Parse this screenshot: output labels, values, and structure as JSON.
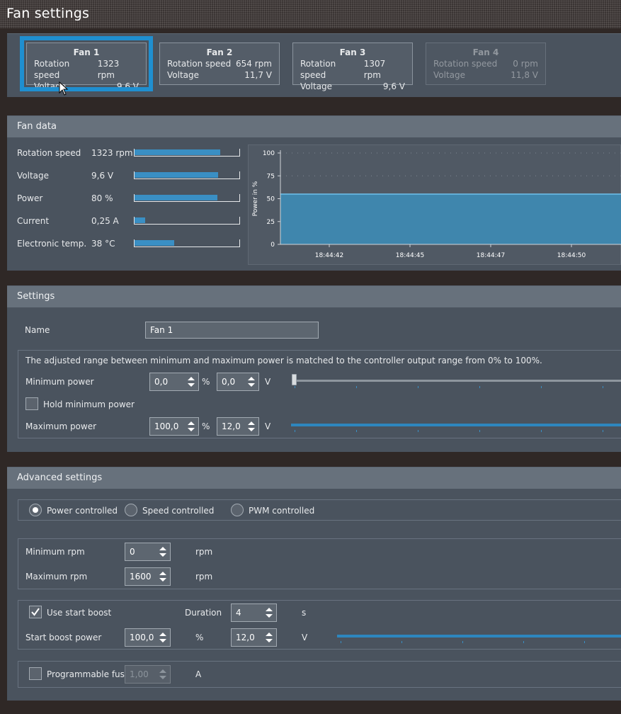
{
  "window": {
    "title": "Fan settings"
  },
  "fans": [
    {
      "title": "Fan 1",
      "rot_label": "Rotation speed",
      "rot_value": "1323 rpm",
      "volt_label": "Voltage",
      "volt_value": "9,6 V"
    },
    {
      "title": "Fan 2",
      "rot_label": "Rotation speed",
      "rot_value": "654 rpm",
      "volt_label": "Voltage",
      "volt_value": "11,7 V"
    },
    {
      "title": "Fan 3",
      "rot_label": "Rotation speed",
      "rot_value": "1307 rpm",
      "volt_label": "Voltage",
      "volt_value": "9,6 V"
    },
    {
      "title": "Fan 4",
      "rot_label": "Rotation speed",
      "rot_value": "0 rpm",
      "volt_label": "Voltage",
      "volt_value": "11,8 V"
    }
  ],
  "fan_data": {
    "header": "Fan data",
    "rows": [
      {
        "label": "Rotation speed",
        "value": "1323 rpm",
        "fill": 0.82
      },
      {
        "label": "Voltage",
        "value": "9,6 V",
        "fill": 0.8
      },
      {
        "label": "Power",
        "value": "80 %",
        "fill": 0.79
      },
      {
        "label": "Current",
        "value": "0,25 A",
        "fill": 0.1
      },
      {
        "label": "Electronic temp.",
        "value": "38 °C",
        "fill": 0.38
      }
    ]
  },
  "chart_data": {
    "type": "area",
    "ylabel": "Power in %",
    "ylim": [
      0,
      100
    ],
    "yticks": [
      "100",
      "75",
      "50",
      "25",
      "0"
    ],
    "xticks": [
      "18:44:42",
      "18:44:45",
      "18:44:47",
      "18:44:50"
    ],
    "series": [
      {
        "values": [
          55,
          55,
          55,
          55,
          55
        ]
      }
    ],
    "colors": {
      "fill": "#3f86ad",
      "line": "#6fc0ec"
    }
  },
  "settings": {
    "header": "Settings",
    "name_label": "Name",
    "name_value": "Fan 1",
    "info": "The adjusted range between minimum and maximum power is matched to the controller output range from 0% to 100%.",
    "min_power_label": "Minimum power",
    "min_power_pct": "0,0",
    "min_power_v": "0,0",
    "hold_label": "Hold minimum power",
    "max_power_label": "Maximum power",
    "max_power_pct": "100,0",
    "max_power_v": "12,0",
    "pct_unit": "%",
    "v_unit": "V"
  },
  "advanced": {
    "header": "Advanced settings",
    "mode_power": "Power controlled",
    "mode_speed": "Speed controlled",
    "mode_pwm": "PWM controlled",
    "min_rpm_label": "Minimum rpm",
    "min_rpm": "0",
    "max_rpm_label": "Maximum rpm",
    "max_rpm": "1600",
    "rpm_unit": "rpm",
    "boost_label": "Use start boost",
    "duration_label": "Duration",
    "duration": "4",
    "s_unit": "s",
    "boost_power_label": "Start boost power",
    "boost_pct": "100,0",
    "boost_v": "12,0",
    "pct_unit": "%",
    "v_unit": "V",
    "fuse_label": "Programmable fuse",
    "fuse_value": "1,00",
    "a_unit": "A"
  },
  "colors": {
    "accent": "#1f8fd0",
    "bar": "#3a8fc4",
    "panel": "#4a535e",
    "header": "#67717c"
  }
}
